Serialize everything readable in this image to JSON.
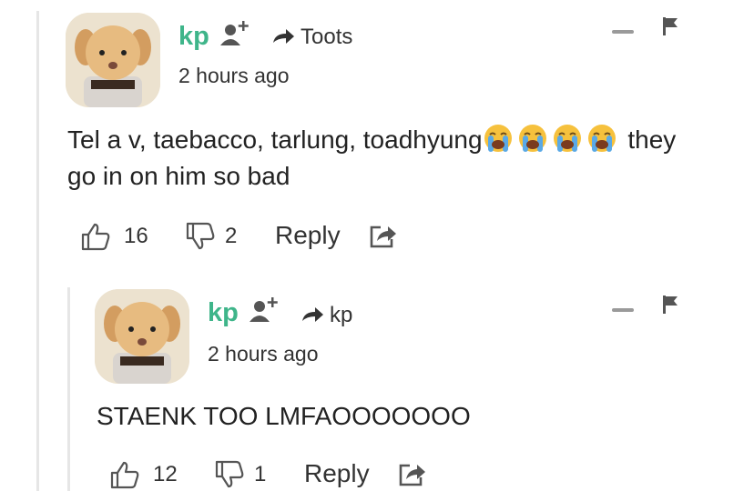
{
  "comments": [
    {
      "username": "kp",
      "reply_to": "Toots",
      "time": "2 hours ago",
      "text_before_emoji": "Tel a v, taebacco, tarlung, toadhyung",
      "emoji_icon": "loudly-crying-face-icon",
      "emoji_count": 4,
      "text_after_emoji": " they",
      "text_line2": "go in on him so bad",
      "upvotes": "16",
      "downvotes": "2",
      "reply_label": "Reply"
    },
    {
      "username": "kp",
      "reply_to": "kp",
      "time": "2 hours ago",
      "text": "STAENK TOO LMFAOOOOOOO",
      "upvotes": "12",
      "downvotes": "1",
      "reply_label": "Reply"
    }
  ],
  "colors": {
    "username": "#3fb58a",
    "text": "#222222",
    "muted_icon": "#9a9a9a",
    "thread_line": "#e6e6e6"
  }
}
